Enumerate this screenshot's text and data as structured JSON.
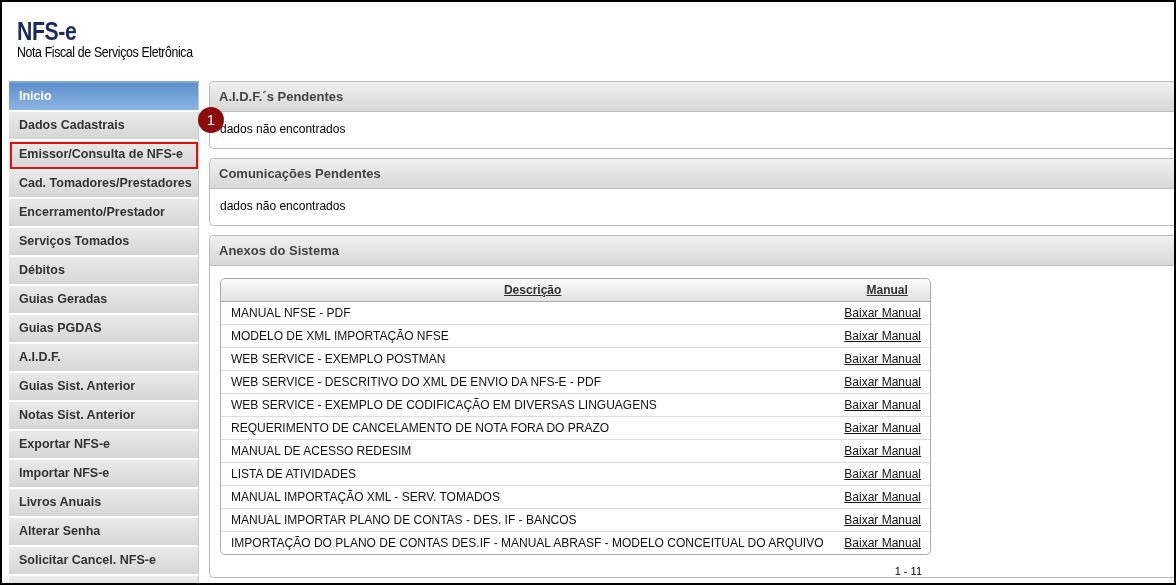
{
  "header": {
    "title": "NFS-e",
    "subtitle": "Nota Fiscal de Serviços Eletrônica"
  },
  "sidebar": {
    "items": [
      {
        "label": "Inicio",
        "selected": true,
        "highlighted": false
      },
      {
        "label": "Dados Cadastrais",
        "selected": false,
        "highlighted": false
      },
      {
        "label": "Emissor/Consulta de NFS-e",
        "selected": false,
        "highlighted": true
      },
      {
        "label": "Cad. Tomadores/Prestadores",
        "selected": false,
        "highlighted": false
      },
      {
        "label": "Encerramento/Prestador",
        "selected": false,
        "highlighted": false
      },
      {
        "label": "Serviços Tomados",
        "selected": false,
        "highlighted": false
      },
      {
        "label": "Débitos",
        "selected": false,
        "highlighted": false
      },
      {
        "label": "Guias Geradas",
        "selected": false,
        "highlighted": false
      },
      {
        "label": "Guias PGDAS",
        "selected": false,
        "highlighted": false
      },
      {
        "label": "A.I.D.F.",
        "selected": false,
        "highlighted": false
      },
      {
        "label": "Guias Sist. Anterior",
        "selected": false,
        "highlighted": false
      },
      {
        "label": "Notas Sist. Anterior",
        "selected": false,
        "highlighted": false
      },
      {
        "label": "Exportar NFS-e",
        "selected": false,
        "highlighted": false
      },
      {
        "label": "Importar NFS-e",
        "selected": false,
        "highlighted": false
      },
      {
        "label": "Livros Anuais",
        "selected": false,
        "highlighted": false
      },
      {
        "label": "Alterar Senha",
        "selected": false,
        "highlighted": false
      },
      {
        "label": "Solicitar Cancel. NFS-e",
        "selected": false,
        "highlighted": false
      }
    ]
  },
  "step_badge": "1",
  "panels": [
    {
      "kind": "message",
      "title": "A.I.D.F.´s Pendentes",
      "message": "dados não encontrados"
    },
    {
      "kind": "message",
      "title": "Comunicações Pendentes",
      "message": "dados não encontrados"
    },
    {
      "kind": "table",
      "title": "Anexos do Sistema",
      "table": {
        "columns": [
          "Descrição",
          "Manual"
        ],
        "rows": [
          {
            "description": "MANUAL NFSE - PDF",
            "link": "Baixar Manual"
          },
          {
            "description": "MODELO DE XML IMPORTAÇÃO NFSE",
            "link": "Baixar Manual"
          },
          {
            "description": "WEB SERVICE - EXEMPLO POSTMAN",
            "link": "Baixar Manual"
          },
          {
            "description": "WEB SERVICE - DESCRITIVO DO XML DE ENVIO DA NFS-E - PDF",
            "link": "Baixar Manual"
          },
          {
            "description": "WEB SERVICE - EXEMPLO DE CODIFICAÇÃO EM DIVERSAS LINGUAGENS",
            "link": "Baixar Manual"
          },
          {
            "description": "REQUERIMENTO DE CANCELAMENTO DE NOTA FORA DO PRAZO",
            "link": "Baixar Manual"
          },
          {
            "description": "MANUAL DE ACESSO REDESIM",
            "link": "Baixar Manual"
          },
          {
            "description": "LISTA DE ATIVIDADES",
            "link": "Baixar Manual"
          },
          {
            "description": "MANUAL IMPORTAÇÃO XML - SERV. TOMADOS",
            "link": "Baixar Manual"
          },
          {
            "description": "MANUAL IMPORTAR PLANO DE CONTAS - DES. IF - BANCOS",
            "link": "Baixar Manual"
          },
          {
            "description": "IMPORTAÇÃO DO PLANO DE CONTAS DES.IF - MANUAL ABRASF - MODELO CONCEITUAL DO ARQUIVO",
            "link": "Baixar Manual"
          }
        ],
        "pagination": "1 - 11"
      }
    }
  ]
}
